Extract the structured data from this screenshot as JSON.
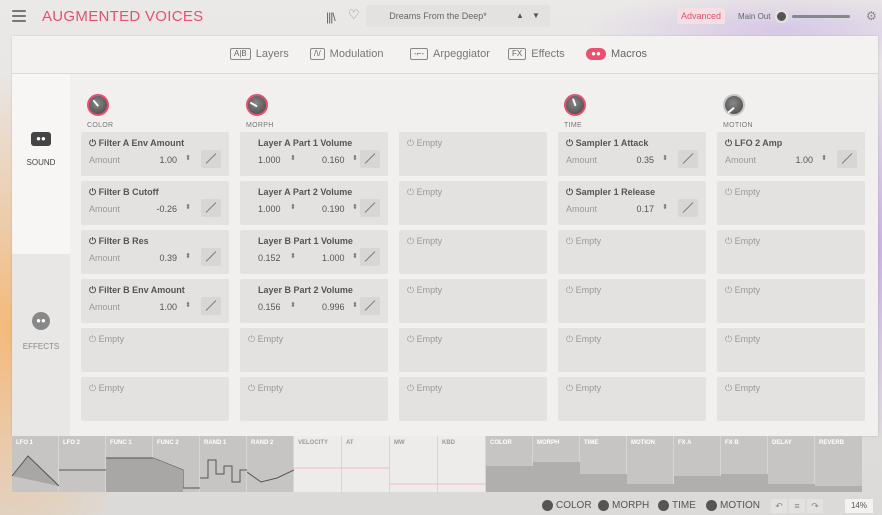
{
  "header": {
    "app_title": "AUGMENTED VOICES",
    "preset_name": "Dreams From the Deep*",
    "advanced_label": "Advanced",
    "main_out_label": "Main Out",
    "prev_glyph": "▲",
    "next_glyph": "▼",
    "icons": [
      "menu-icon",
      "library-icon",
      "heart-icon",
      "settings-icon"
    ]
  },
  "tabs": [
    {
      "icon": "A|B",
      "label": "Layers"
    },
    {
      "icon": "/\\/",
      "label": "Modulation"
    },
    {
      "icon": "-⌐-",
      "label": "Arpeggiator"
    },
    {
      "icon": "FX",
      "label": "Effects"
    },
    {
      "icon": "●●",
      "label": "Macros",
      "active": true
    }
  ],
  "sidebar": {
    "sound_label": "SOUND",
    "effects_label": "EFFECTS"
  },
  "macros": {
    "color": {
      "name": "COLOR",
      "slots": [
        {
          "title": "Filter A Env Amount",
          "amount_label": "Amount",
          "amount": "1.00"
        },
        {
          "title": "Filter B Cutoff",
          "amount_label": "Amount",
          "amount": "-0.26"
        },
        {
          "title": "Filter B Res",
          "amount_label": "Amount",
          "amount": "0.39"
        },
        {
          "title": "Filter B Env Amount",
          "amount_label": "Amount",
          "amount": "1.00"
        },
        {
          "title": "Empty"
        },
        {
          "title": "Empty"
        }
      ]
    },
    "morph": {
      "name": "MORPH",
      "slots": [
        {
          "title": "Layer A Part 1 Volume",
          "v1": "1.000",
          "v2": "0.160"
        },
        {
          "title": "Layer A Part 2 Volume",
          "v1": "1.000",
          "v2": "0.190"
        },
        {
          "title": "Layer B Part 1 Volume",
          "v1": "0.152",
          "v2": "1.000"
        },
        {
          "title": "Layer B Part 2 Volume",
          "v1": "0.156",
          "v2": "0.996"
        },
        {
          "title": "Empty"
        },
        {
          "title": "Empty"
        }
      ]
    },
    "extra": {
      "slots": [
        {
          "title": "Empty"
        },
        {
          "title": "Empty"
        },
        {
          "title": "Empty"
        },
        {
          "title": "Empty"
        },
        {
          "title": "Empty"
        },
        {
          "title": "Empty"
        }
      ]
    },
    "time": {
      "name": "TIME",
      "slots": [
        {
          "title": "Sampler 1 Attack",
          "amount_label": "Amount",
          "amount": "0.35"
        },
        {
          "title": "Sampler 1 Release",
          "amount_label": "Amount",
          "amount": "0.17"
        },
        {
          "title": "Empty"
        },
        {
          "title": "Empty"
        },
        {
          "title": "Empty"
        },
        {
          "title": "Empty"
        }
      ]
    },
    "motion": {
      "name": "MOTION",
      "slots": [
        {
          "title": "LFO 2 Amp",
          "amount_label": "Amount",
          "amount": "1.00"
        },
        {
          "title": "Empty"
        },
        {
          "title": "Empty"
        },
        {
          "title": "Empty"
        },
        {
          "title": "Empty"
        },
        {
          "title": "Empty"
        }
      ]
    }
  },
  "mod_sources": [
    "LFO 1",
    "LFO 2",
    "FUNC 1",
    "FUNC 2",
    "RAND 1",
    "RAND 2",
    "VELOCITY",
    "AT",
    "MW",
    "KBD",
    "COLOR",
    "MORPH",
    "TIME",
    "MOTION",
    "FX A",
    "FX B",
    "DELAY",
    "REVERB"
  ],
  "bottom": {
    "macros": [
      "COLOR",
      "MORPH",
      "TIME",
      "MOTION"
    ],
    "undo_glyph": "↶",
    "history_glyph": "≡",
    "redo_glyph": "↷",
    "zoom": "14%"
  }
}
